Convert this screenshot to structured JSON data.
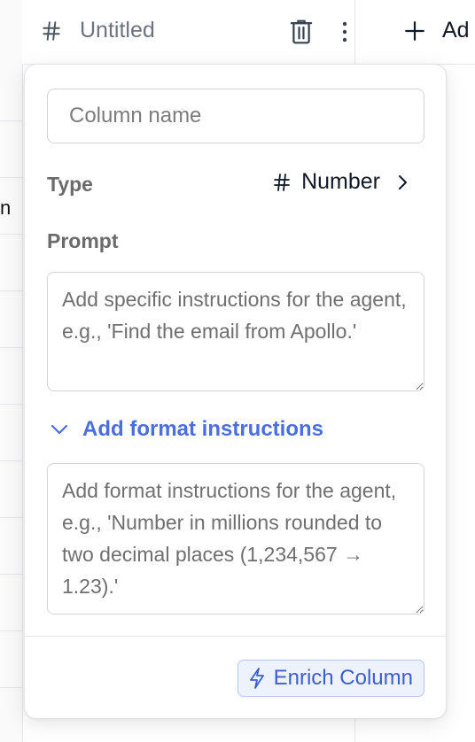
{
  "header": {
    "column_title": "Untitled",
    "add_column_label": "Ad",
    "left_fragment": "n"
  },
  "popover": {
    "column_name_placeholder": "Column name",
    "type_label": "Type",
    "type_value": "Number",
    "prompt_label": "Prompt",
    "prompt_placeholder": "Add specific instructions for the agent, e.g., 'Find the email from Apollo.'",
    "format_toggle_label": "Add format instructions",
    "format_placeholder": "Add format instructions for the agent, e.g., 'Number in millions rounded to two decimal places (1,234,567 → 1.23).'",
    "enrich_button_label": "Enrich Column"
  },
  "colors": {
    "accent": "#4a6fdc",
    "button_bg": "#eef2fd",
    "button_border": "#b7c6f2",
    "border": "#d1d5db"
  },
  "icons": [
    "hash-icon",
    "trash-icon",
    "more-vertical-icon",
    "plus-icon",
    "chevron-right-icon",
    "chevron-down-icon",
    "lightning-icon",
    "resize-handle-icon"
  ]
}
